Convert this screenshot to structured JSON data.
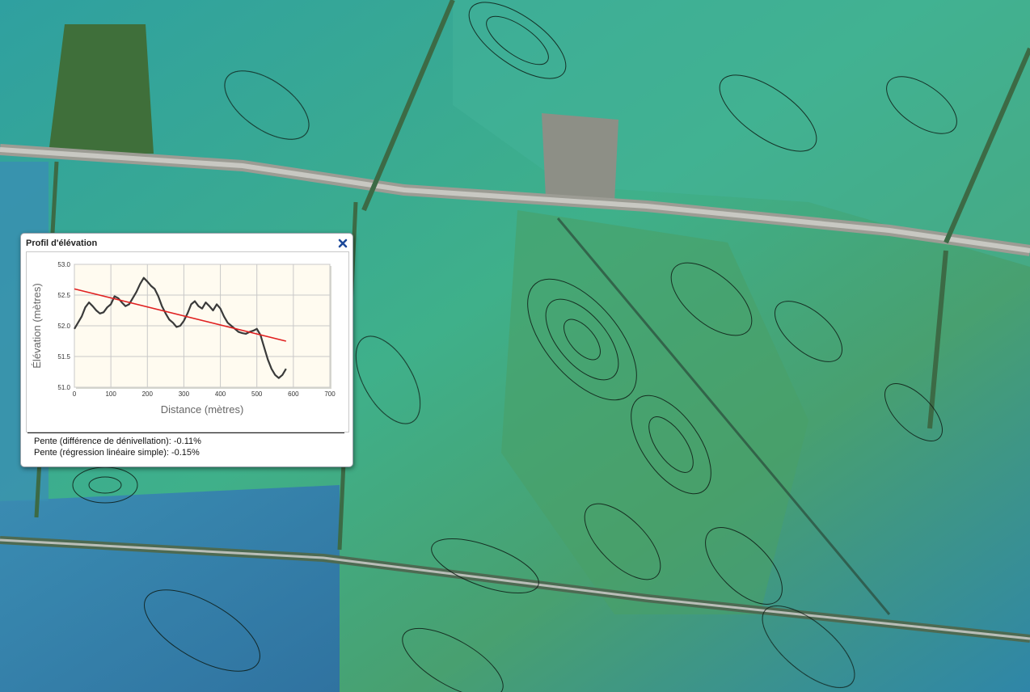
{
  "map": {
    "layer": "elevation-contours"
  },
  "panel": {
    "title": "Profil d'élévation",
    "close_icon": "close-x-icon",
    "slope_difference": "Pente (différence de dénivellation): -0.11%",
    "slope_regression": "Pente (régression linéaire simple): -0.15%"
  },
  "chart_data": {
    "type": "line",
    "xlabel": "Distance (mètres)",
    "ylabel": "Élévation (mètres)",
    "xlim": [
      0,
      700
    ],
    "ylim": [
      51.0,
      53.0
    ],
    "xticks": [
      0,
      100,
      200,
      300,
      400,
      500,
      600,
      700
    ],
    "yticks": [
      51.0,
      51.5,
      52.0,
      52.5,
      53.0
    ],
    "grid": true,
    "series": [
      {
        "color": "#3a3a3a",
        "x": [
          0,
          10,
          20,
          30,
          40,
          50,
          60,
          70,
          80,
          90,
          100,
          110,
          120,
          130,
          140,
          150,
          160,
          170,
          180,
          190,
          200,
          210,
          220,
          230,
          240,
          250,
          260,
          270,
          280,
          290,
          300,
          310,
          320,
          330,
          340,
          350,
          360,
          370,
          380,
          390,
          400,
          410,
          420,
          430,
          440,
          450,
          460,
          470,
          480,
          490,
          500,
          510,
          520,
          530,
          540,
          550,
          560,
          570,
          580
        ],
        "y": [
          51.95,
          52.05,
          52.15,
          52.3,
          52.38,
          52.32,
          52.25,
          52.2,
          52.22,
          52.3,
          52.35,
          52.48,
          52.45,
          52.38,
          52.32,
          52.35,
          52.45,
          52.55,
          52.68,
          52.78,
          52.72,
          52.65,
          52.6,
          52.48,
          52.32,
          52.2,
          52.1,
          52.05,
          51.98,
          52.0,
          52.08,
          52.2,
          52.35,
          52.4,
          52.32,
          52.28,
          52.38,
          52.32,
          52.25,
          52.35,
          52.28,
          52.15,
          52.05,
          52.0,
          51.95,
          51.9,
          51.88,
          51.87,
          51.9,
          51.92,
          51.95,
          51.85,
          51.65,
          51.45,
          51.3,
          51.2,
          51.15,
          51.2,
          51.3
        ]
      },
      {
        "color": "#e02020",
        "x": [
          0,
          580
        ],
        "y": [
          52.6,
          51.75
        ]
      }
    ]
  }
}
